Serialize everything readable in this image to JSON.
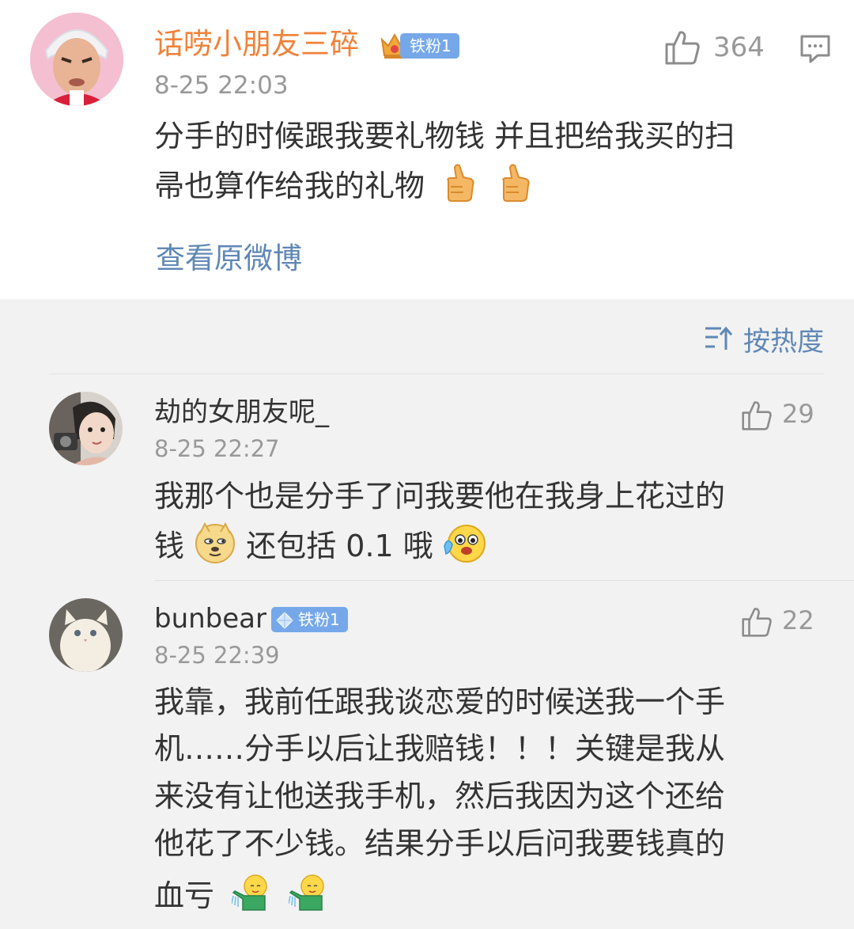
{
  "post": {
    "author": "话唠小朋友三碎",
    "badge": "铁粉1",
    "time": "8-25 22:03",
    "likes": "364",
    "text_line1": "分手的时候跟我要礼物钱 并且把给我买的扫",
    "text_line2": "帚也算作给我的礼物",
    "emojis": [
      "thumbs-up-emoji",
      "thumbs-up-emoji"
    ],
    "view_original": "查看原微博"
  },
  "sort": {
    "label": "按热度",
    "icon": "sort-icon"
  },
  "comments": [
    {
      "author": "劫的女朋友呢_",
      "time": "8-25 22:27",
      "likes": "29",
      "line1": "我那个也是分手了问我要他在我身上花过的",
      "line2_a": "钱",
      "line2_b": "还包括 0.1 哦",
      "emojis": [
        "doge-emoji",
        "tearful-emoji"
      ]
    },
    {
      "author": "bunbear",
      "badge": "铁粉1",
      "time": "8-25 22:39",
      "likes": "22",
      "lines": [
        "我靠，我前任跟我谈恋爱的时候送我一个手",
        "机……分手以后让我赔钱！！！关键是我从",
        "来没有让他送我手机，然后我因为这个还给",
        "他花了不少钱。结果分手以后问我要钱真的",
        "血亏"
      ],
      "emojis": [
        "watering-can-emoji",
        "watering-can-emoji"
      ]
    }
  ],
  "colors": {
    "author_orange": "#f08138",
    "link_blue": "#5f88b5",
    "badge_blue": "#76a8e9",
    "text": "#333333",
    "muted": "#999999",
    "page_bg": "#f2f2f2"
  }
}
